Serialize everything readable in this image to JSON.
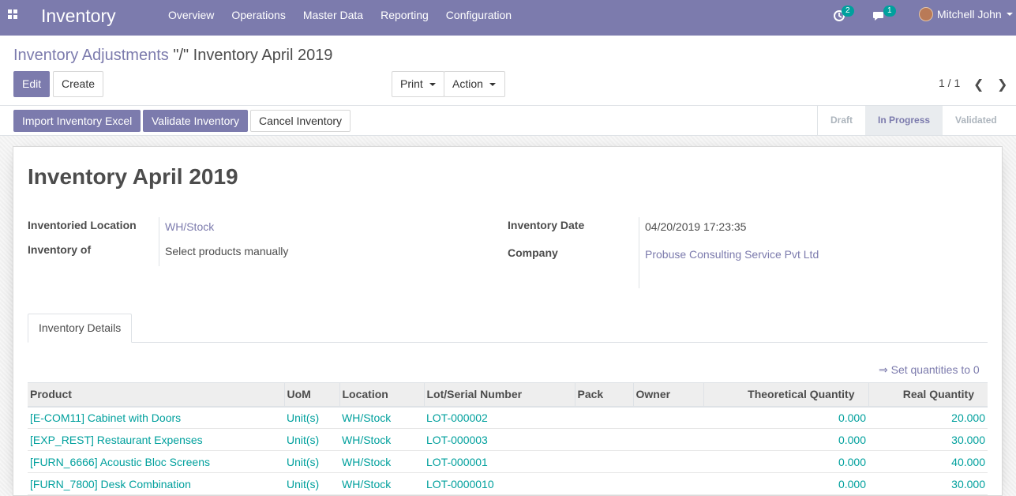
{
  "navbar": {
    "brand": "Inventory",
    "menu": [
      "Overview",
      "Operations",
      "Master Data",
      "Reporting",
      "Configuration"
    ],
    "activity_count": "2",
    "message_count": "1",
    "user_name": "Mitchell John"
  },
  "control_panel": {
    "breadcrumb_parent": "Inventory Adjustments",
    "breadcrumb_current": "\"/\" Inventory April 2019",
    "edit_label": "Edit",
    "create_label": "Create",
    "print_label": "Print",
    "action_label": "Action",
    "pager": "1 / 1",
    "pager_prev": "❮",
    "pager_next": "❯"
  },
  "statusbar": {
    "import_label": "Import Inventory Excel",
    "validate_label": "Validate Inventory",
    "cancel_label": "Cancel Inventory",
    "stages": [
      "Draft",
      "In Progress",
      "Validated"
    ],
    "active_stage": "In Progress"
  },
  "form": {
    "title": "Inventory April 2019",
    "inventoried_location_label": "Inventoried Location",
    "inventoried_location": "WH/Stock",
    "inventory_of_label": "Inventory of",
    "inventory_of": "Select products manually",
    "inventory_date_label": "Inventory Date",
    "inventory_date": "04/20/2019 17:23:35",
    "company_label": "Company",
    "company": "Probuse Consulting Service Pvt Ltd"
  },
  "tabs": [
    "Inventory Details"
  ],
  "set_quantities": "⇒ Set quantities to 0",
  "lines": {
    "columns": [
      "Product",
      "UoM",
      "Location",
      "Lot/Serial Number",
      "Pack",
      "Owner",
      "Theoretical Quantity",
      "Real Quantity"
    ],
    "rows": [
      [
        "[E-COM11] Cabinet with Doors",
        "Unit(s)",
        "WH/Stock",
        "LOT-000002",
        "",
        "",
        "0.000",
        "20.000"
      ],
      [
        "[EXP_REST] Restaurant Expenses",
        "Unit(s)",
        "WH/Stock",
        "LOT-000003",
        "",
        "",
        "0.000",
        "30.000"
      ],
      [
        "[FURN_6666] Acoustic Bloc Screens",
        "Unit(s)",
        "WH/Stock",
        "LOT-000001",
        "",
        "",
        "0.000",
        "40.000"
      ],
      [
        "[FURN_7800] Desk Combination",
        "Unit(s)",
        "WH/Stock",
        "LOT-0000010",
        "",
        "",
        "0.000",
        "30.000"
      ]
    ]
  },
  "colors": {
    "brand": "#7c7bad",
    "link": "#00a09d"
  }
}
